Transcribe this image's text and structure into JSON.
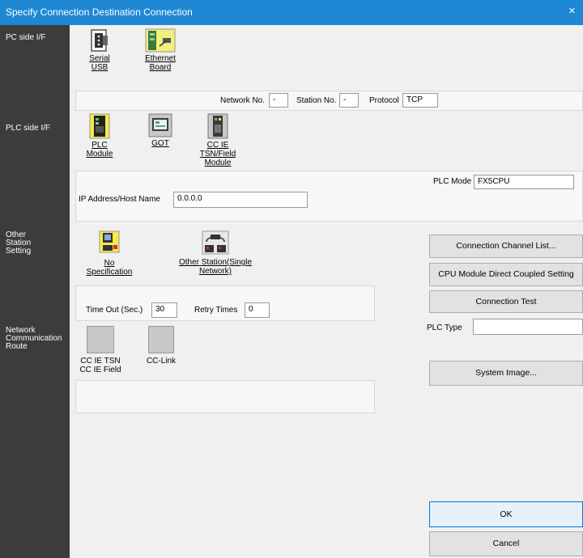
{
  "title": "Specify Connection Destination Connection",
  "close_glyph": "×",
  "sidebar": {
    "pc_side": "PC side I/F",
    "plc_side": "PLC side I/F",
    "other_station": [
      "Other",
      "Station",
      "Setting"
    ],
    "network_route": [
      "Network",
      "Communication",
      "Route"
    ]
  },
  "pc_side": {
    "serial_usb": [
      "Serial",
      "USB"
    ],
    "ethernet_board": [
      "Ethernet",
      "Board"
    ]
  },
  "network_row": {
    "network_no_label": "Network No.",
    "network_no_value": "-",
    "station_no_label": "Station No.",
    "station_no_value": "-",
    "protocol_label": "Protocol",
    "protocol_value": "TCP"
  },
  "plc_side": {
    "plc_module": [
      "PLC",
      "Module"
    ],
    "got": "GOT",
    "cc_ie": [
      "CC IE",
      "TSN/Field",
      "Module"
    ]
  },
  "plc_panel": {
    "plc_mode_label": "PLC Mode",
    "plc_mode_value": "FX5CPU",
    "ip_label": "IP Address/Host Name",
    "ip_value": "0.0.0.0"
  },
  "other_station": {
    "no_spec": "No Specification",
    "single_network": [
      "Other Station(Single",
      "Network)"
    ]
  },
  "timeout_row": {
    "timeout_label": "Time Out (Sec.)",
    "timeout_value": "30",
    "retry_label": "Retry Times",
    "retry_value": "0"
  },
  "network_route": {
    "cc_ie_tsn": [
      "CC IE TSN",
      "CC IE Field"
    ],
    "cc_link": "CC-Link"
  },
  "buttons": {
    "connection_channel": "Connection Channel List...",
    "cpu_direct": "CPU Module Direct Coupled Setting",
    "connection_test": "Connection Test",
    "plc_type_label": "PLC Type",
    "plc_type_value": "",
    "system_image": "System Image...",
    "ok": "OK",
    "cancel": "Cancel"
  }
}
